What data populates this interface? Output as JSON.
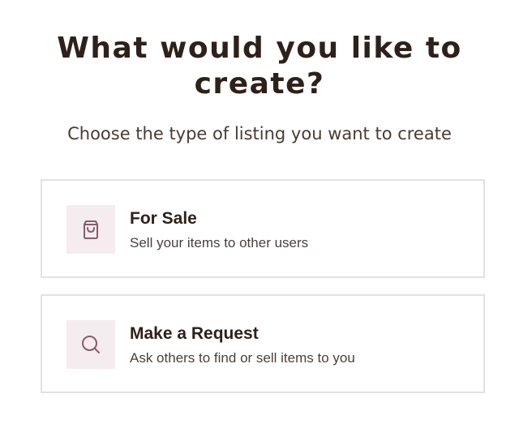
{
  "header": {
    "title": "What would you like to create?",
    "subtitle": "Choose the type of listing you want to create"
  },
  "options": [
    {
      "icon": "shopping-bag-icon",
      "title": "For Sale",
      "description": "Sell your items to other users"
    },
    {
      "icon": "search-icon",
      "title": "Make a Request",
      "description": "Ask others to find or sell items to you"
    }
  ],
  "colors": {
    "text_primary": "#2e2119",
    "text_secondary": "#4a3f3b",
    "icon_accent": "#8a5b6b",
    "icon_background": "#f4ecee",
    "card_border": "#e4e1e0"
  }
}
